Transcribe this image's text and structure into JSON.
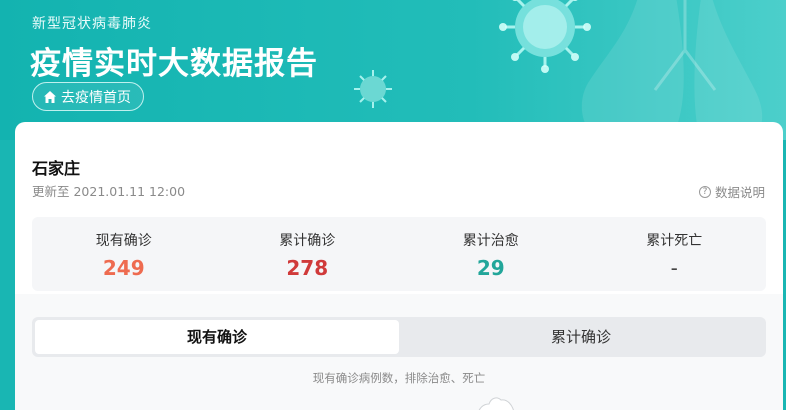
{
  "header": {
    "subtitle": "新型冠状病毒肺炎",
    "title": "疫情实时大数据报告",
    "home_button": "去疫情首页",
    "home_icon": "home-icon"
  },
  "summary": {
    "city": "石家庄",
    "updated": "更新至 2021.01.11 12:00",
    "data_explain": "数据说明",
    "help_icon": "question-circle-icon"
  },
  "stats": [
    {
      "label": "现有确诊",
      "value": "249",
      "color": "#ee6b50"
    },
    {
      "label": "累计确诊",
      "value": "278",
      "color": "#d03a3a"
    },
    {
      "label": "累计治愈",
      "value": "29",
      "color": "#22a69a"
    },
    {
      "label": "累计死亡",
      "value": "-",
      "color": "#444444"
    }
  ],
  "tabs": [
    {
      "label": "现有确诊",
      "active": true
    },
    {
      "label": "累计确诊",
      "active": false
    }
  ],
  "note": "现有确诊病例数，排除治愈、死亡",
  "colors": {
    "brand": "#19b6b3",
    "current_confirmed": "#ee6b50",
    "total_confirmed": "#d03a3a",
    "cured": "#22a69a"
  }
}
